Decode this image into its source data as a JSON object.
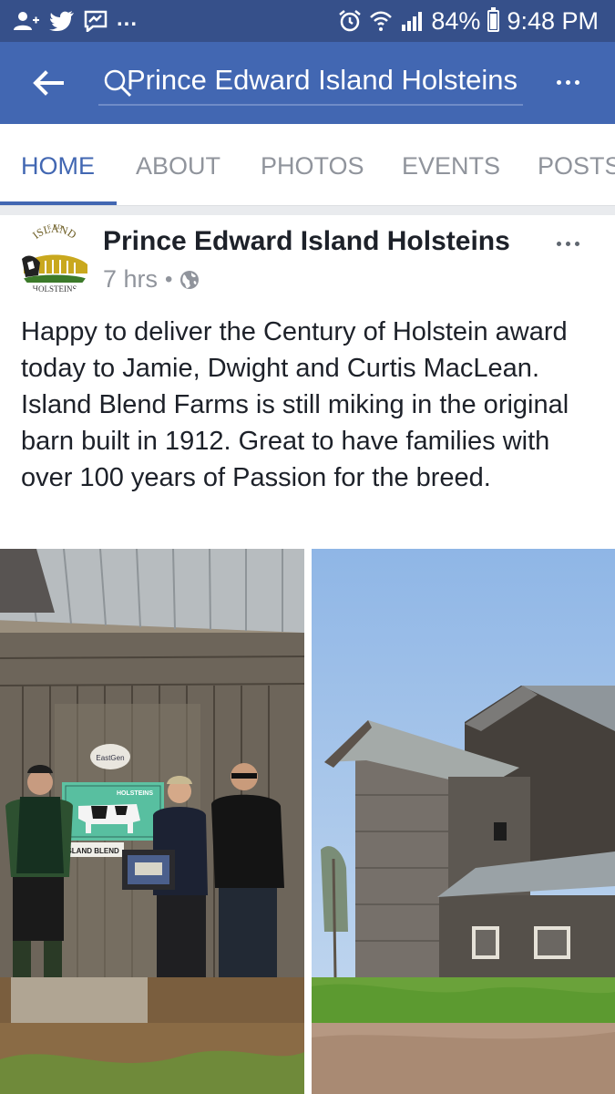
{
  "status_bar": {
    "left_icons": [
      "add-friend-icon",
      "twitter-icon",
      "messenger-icon"
    ],
    "ellipsis": "...",
    "battery": "84%",
    "battery_level": 0.84,
    "time": "9:48 PM",
    "right_icons": [
      "alarm-icon",
      "wifi-icon",
      "signal-icon",
      "battery-icon"
    ]
  },
  "app_bar": {
    "color": "#4267b2",
    "search_text": "Prince Edward Island Holsteins",
    "back_icon": "back-arrow-icon",
    "search_icon": "search-icon",
    "more_icon": "more-options-icon"
  },
  "tabs": [
    {
      "label": "HOME",
      "active": true
    },
    {
      "label": "ABOUT",
      "active": false
    },
    {
      "label": "PHOTOS",
      "active": false
    },
    {
      "label": "EVENTS",
      "active": false
    },
    {
      "label": "POSTS",
      "active": false
    }
  ],
  "post": {
    "page_name": "Prince Edward Island Holsteins",
    "time": "7 hrs",
    "separator": "•",
    "audience_icon": "globe-icon",
    "avatar": {
      "arc_text": "ISLAND",
      "bottom_text": "HOLSTEINS",
      "top_text": "E ED"
    },
    "text": "Happy to deliver the Century of Holstein award today to Jamie,  Dwight and Curtis MacLean. Island Blend Farms is still miking in the original barn built in 1912.  Great to have families with over 100 years of Passion for the breed.",
    "photos": [
      {
        "name": "group-photo",
        "sign_text": "HOLSTEINS",
        "sign_subtext": "ISLAND BLEND",
        "logo_text": "EastGen"
      },
      {
        "name": "barn-photo"
      }
    ]
  }
}
